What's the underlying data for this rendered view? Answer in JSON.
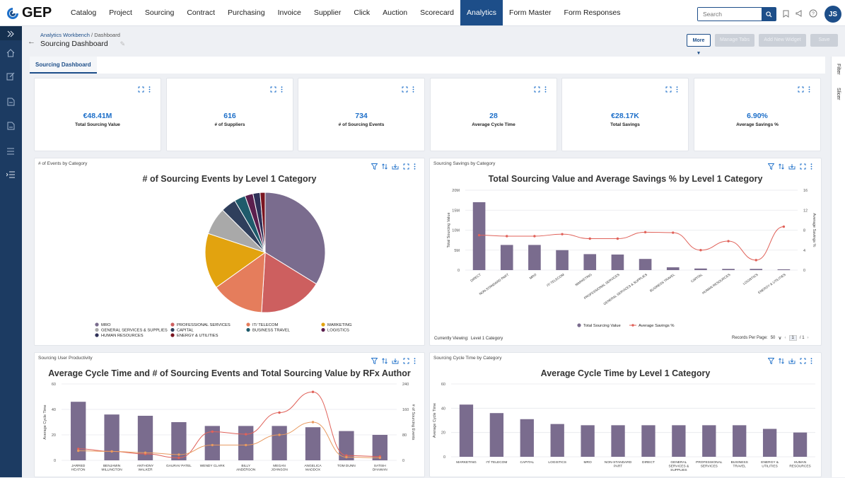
{
  "brand": {
    "name": "GEP"
  },
  "nav": {
    "items": [
      "Catalog",
      "Project",
      "Sourcing",
      "Contract",
      "Purchasing",
      "Invoice",
      "Supplier",
      "Click",
      "Auction",
      "Scorecard",
      "Analytics",
      "Form Master",
      "Form Responses"
    ],
    "active": "Analytics",
    "search_placeholder": "Search",
    "user_initials": "JS"
  },
  "icons": {
    "top": [
      "search-icon",
      "bookmark-icon",
      "megaphone-icon",
      "help-icon"
    ],
    "sidebar": [
      "expand-icon",
      "home-icon",
      "edit-icon",
      "document-icon",
      "report-icon",
      "list-icon",
      "menu-list-icon"
    ],
    "kpi": [
      "expand-icon",
      "kebab-icon"
    ],
    "panel": [
      "filter-icon",
      "sort-icon",
      "download-icon",
      "expand-icon",
      "kebab-icon"
    ]
  },
  "header": {
    "breadcrumb_parent": "Analytics Workbench",
    "breadcrumb_separator": "/",
    "breadcrumb_current": "Dashboard",
    "title": "Sourcing Dashboard",
    "buttons": {
      "more": "More",
      "manage_tabs": "Manage Tabs",
      "add_widget": "Add New Widget",
      "save": "Save"
    }
  },
  "tabs": [
    "Sourcing Dashboard"
  ],
  "right_panel": [
    "Filter",
    "Slicer"
  ],
  "kpis": [
    {
      "value": "€48.41M",
      "label": "Total Sourcing Value"
    },
    {
      "value": "616",
      "label": "# of Suppliers"
    },
    {
      "value": "734",
      "label": "# of Sourcing Events"
    },
    {
      "value": "28",
      "label": "Average Cycle Time"
    },
    {
      "value": "€28.17K",
      "label": "Total Savings"
    },
    {
      "value": "6.90%",
      "label": "Average Savings %"
    }
  ],
  "panels": {
    "events": {
      "header": "# of Events by Category"
    },
    "savings": {
      "header": "Sourcing Savings by Category",
      "currently_viewing_label": "Currently Viewing:",
      "currently_viewing_value": "Level 1 Category",
      "records_label": "Records Per Page:",
      "records_value": "50",
      "page_current": "1",
      "page_total": "/ 1"
    },
    "productivity": {
      "header": "Sourcing User Productivity"
    },
    "cycle": {
      "header": "Sourcing Cycle Time by Category"
    }
  },
  "chart_data": [
    {
      "type": "pie",
      "title": "# of Sourcing Events by Level 1 Category",
      "categories": [
        "MRO",
        "PROFESSIONAL SERVICES",
        "IT/ TELECOM",
        "MARKETING",
        "GENERAL SERVICES & SUPPLIES",
        "CAPITAL",
        "BUSINESS TRAVEL",
        "LOGISTICS",
        "HUMAN RESOURCES",
        "ENERGY & UTILITIES"
      ],
      "values": [
        248,
        126,
        104,
        110,
        54,
        30,
        22,
        16,
        14,
        10
      ],
      "colors": [
        "#7a6c8e",
        "#cd5f5f",
        "#e57d5c",
        "#e2a30f",
        "#a9a9a9",
        "#2f3f5c",
        "#1f5b6b",
        "#5b1f4e",
        "#2f3158",
        "#7a1520"
      ],
      "legend_position": "bottom"
    },
    {
      "type": "bar",
      "title": "Total Sourcing Value and Average Savings % by Level 1 Category",
      "categories": [
        "DIRECT",
        "NON-STANDARD PART",
        "MRO",
        "IT/ TELECOM",
        "MARKETING",
        "PROFESSIONAL SERVICES",
        "GENERAL SERVICES & SUPPLIES",
        "BUSINESS TRAVEL",
        "CAPITAL",
        "HUMAN RESOURCES",
        "LOGISTICS",
        "ENERGY & UTILITIES"
      ],
      "series": [
        {
          "name": "Total Sourcing Value",
          "type": "bar",
          "axis": "left",
          "values": [
            17000000,
            6300000,
            6300000,
            5000000,
            4000000,
            3900000,
            2800000,
            700000,
            400000,
            300000,
            300000,
            200000
          ],
          "color": "#7a6c8e"
        },
        {
          "name": "Average Savings %",
          "type": "line",
          "axis": "right",
          "values": [
            7,
            6.8,
            6.8,
            7.2,
            6.3,
            6.3,
            7.6,
            7.5,
            4,
            5.8,
            2,
            8.7
          ],
          "color": "#e0625a"
        }
      ],
      "ylabel": "Total Sourcing Value",
      "y2label": "Average Savings %",
      "ylim": [
        0,
        20000000
      ],
      "yticks": [
        "0",
        "5M",
        "10M",
        "15M",
        "20M"
      ],
      "y2lim": [
        0,
        16
      ],
      "y2ticks": [
        "0",
        "4",
        "8",
        "12",
        "16"
      ],
      "legend_position": "bottom"
    },
    {
      "type": "bar",
      "title": "Average Cycle Time and # of Sourcing Events and Total Sourcing Value by RFx Author",
      "categories": [
        "JARRED HEATON",
        "BENJAMIN MILLINGTON",
        "ANTHONY WALKER",
        "GAURAV PATEL",
        "WENDY CLARK",
        "BILLY ANDERSON",
        "MEGAN JOHNSON",
        "ANGELICA MADDOX",
        "TOM DUNN",
        "SATISH DHAWAN"
      ],
      "series": [
        {
          "name": "Average Cycle Time",
          "type": "bar",
          "axis": "left",
          "values": [
            46,
            36,
            35,
            30,
            27,
            27,
            27,
            26,
            23,
            20
          ],
          "color": "#7a6c8e"
        },
        {
          "name": "# of Sourcing Events",
          "type": "line",
          "axis": "right",
          "values": [
            36,
            28,
            20,
            8,
            90,
            82,
            150,
            215,
            15,
            12
          ],
          "color": "#e0625a"
        },
        {
          "name": "Total Sourcing Value",
          "type": "line",
          "axis": "right",
          "values": [
            30,
            28,
            24,
            18,
            48,
            48,
            80,
            120,
            10,
            8
          ],
          "color": "#e89a60"
        }
      ],
      "ylabel": "Average Cycle Time",
      "y2label": "# of Sourcing Events",
      "ylim": [
        0,
        60
      ],
      "yticks": [
        "0",
        "20",
        "40",
        "60"
      ],
      "y2lim": [
        0,
        240
      ],
      "y2ticks": [
        "0",
        "80",
        "160",
        "240"
      ]
    },
    {
      "type": "bar",
      "title": "Average Cycle Time by Level 1 Category",
      "categories": [
        "MARKETING",
        "IT/ TELECOM",
        "CAPITAL",
        "LOGISTICS",
        "MRO",
        "NON-STANDARD PART",
        "DIRECT",
        "GENERAL SERVICES & SUPPLIES",
        "PROFESSIONAL SERVICES",
        "BUSINESS TRAVEL",
        "ENERGY & UTILITIES",
        "HUMAN RESOURCES"
      ],
      "series": [
        {
          "name": "Average Cycle Time",
          "type": "bar",
          "values": [
            43,
            36,
            31,
            27,
            26,
            26,
            26,
            26,
            26,
            26,
            23,
            20
          ],
          "color": "#7a6c8e"
        }
      ],
      "ylabel": "Average Cycle Time",
      "ylim": [
        0,
        60
      ],
      "yticks": [
        "0",
        "20",
        "40",
        "60"
      ]
    }
  ]
}
